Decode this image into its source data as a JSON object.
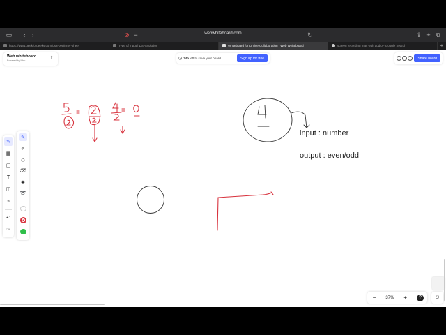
{
  "browser": {
    "url": "webwhiteboard.com",
    "tabs": [
      {
        "label": "https://www.geekforgeeks.com/dsa-beginner-sheet",
        "active": false
      },
      {
        "label": "Type of Input | DSA Solution",
        "active": false
      },
      {
        "label": "Whiteboard for Online Collaboration | Web Whiteboard",
        "active": true
      },
      {
        "label": "screen recording mac with audio - Google Search",
        "active": false
      }
    ]
  },
  "brand": {
    "title": "Web whiteboard",
    "subtitle": "Powered by Miro"
  },
  "save_banner": {
    "bold": "24h",
    "text": " left to save your board",
    "button": "Sign up for free"
  },
  "share": {
    "button": "Share board"
  },
  "canvas": {
    "input_label": "input : number",
    "output_label": "output : even/odd"
  },
  "zoom": {
    "minus": "−",
    "value": "37%",
    "plus": "+",
    "help": "?"
  },
  "colors": {
    "accent": "#4262ff",
    "ink_red": "#d8343f",
    "ink_dark": "#333333",
    "swatch_green": "#2fbf4a"
  },
  "tools": [
    "select-icon",
    "frame-icon",
    "sticky-note-icon",
    "text-icon",
    "shapes-icon",
    "more-icon",
    "undo-icon",
    "redo-icon"
  ],
  "pen_tools": [
    "pen-icon",
    "marker-icon",
    "lasso-shape-icon",
    "highlighter-icon",
    "eraser-icon",
    "lasso-icon"
  ]
}
